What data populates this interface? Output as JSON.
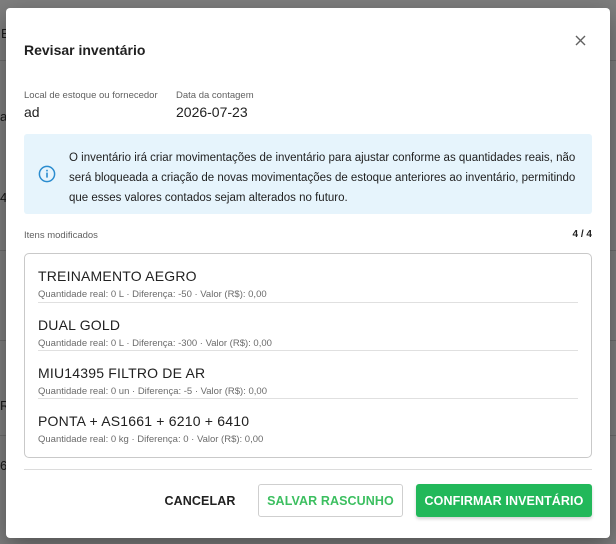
{
  "background": {
    "chars": [
      "E",
      "a",
      "4",
      "R",
      "6"
    ]
  },
  "modal": {
    "title": "Revisar inventário",
    "location_label": "Local de estoque ou fornecedor",
    "location_value": "ad",
    "date_label": "Data da contagem",
    "date_value": "2026-07-23",
    "info_text": "O inventário irá criar movimentações de inventário para ajustar conforme as quantidades reais, não será bloqueada a criação de novas movimentações de estoque anteriores ao inventário, permitindo que esses valores contados sejam alterados no futuro.",
    "section_label": "Itens modificados",
    "section_count": "4 / 4",
    "items": [
      {
        "name": "TREINAMENTO AEGRO",
        "detail": "Quantidade real: 0 L · Diferença: -50 · Valor (R$): 0,00"
      },
      {
        "name": "DUAL GOLD",
        "detail": "Quantidade real: 0 L · Diferença: -300 · Valor (R$): 0,00"
      },
      {
        "name": "MIU14395 FILTRO DE AR",
        "detail": "Quantidade real: 0 un · Diferença: -5 · Valor (R$): 0,00"
      },
      {
        "name": "PONTA + AS1661 + 6210 + 6410",
        "detail": "Quantidade real: 0 kg · Diferença: 0 · Valor (R$): 0,00"
      }
    ],
    "cancel_label": "CANCELAR",
    "draft_label": "SALVAR RASCUNHO",
    "confirm_label": "CONFIRMAR INVENTÁRIO"
  },
  "colors": {
    "primary": "#22b85a",
    "info_bg": "#e6f4fc",
    "info_icon": "#2a8ccf"
  },
  "icons": {
    "close": "close-icon",
    "info": "info-icon"
  }
}
